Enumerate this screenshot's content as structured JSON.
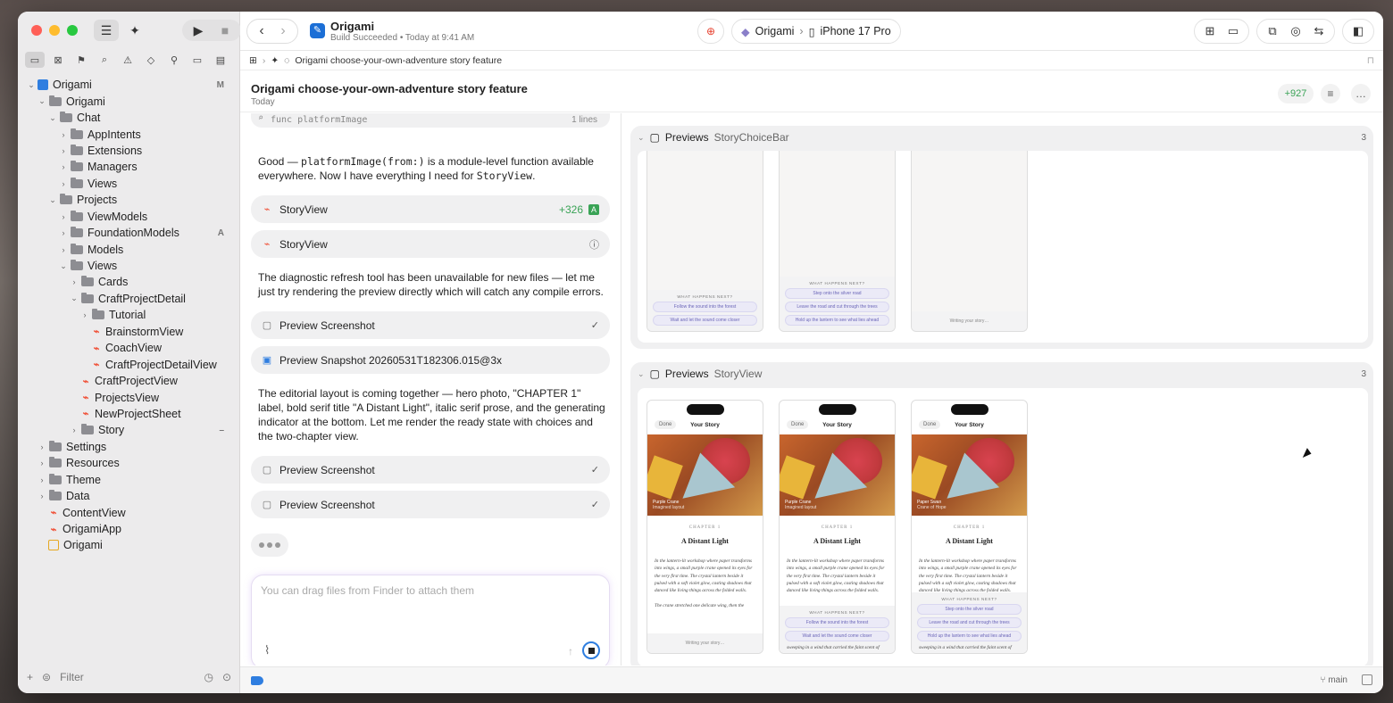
{
  "colors": {
    "accent": "#2f7ee0",
    "added": "#3aa356",
    "swift": "#f05138",
    "close": "#ff5f57",
    "minimize": "#febc2e",
    "zoom": "#28c840"
  },
  "toolbar": {
    "app_title": "Origami",
    "status": "Build Succeeded • Today at 9:41 AM",
    "scheme_app": "Origami",
    "scheme_device": "iPhone 17 Pro"
  },
  "jumpbar": {
    "path": "Origami choose-your-own-adventure story feature"
  },
  "header": {
    "title": "Origami choose-your-own-adventure story feature",
    "date": "Today",
    "diff": "+927"
  },
  "sidebar": {
    "filter_placeholder": "Filter",
    "items": [
      {
        "label": "Origami",
        "type": "project",
        "depth": 0,
        "open": true,
        "badge": "M"
      },
      {
        "label": "Origami",
        "type": "folder",
        "depth": 1,
        "open": true
      },
      {
        "label": "Chat",
        "type": "folder",
        "depth": 2,
        "open": true
      },
      {
        "label": "AppIntents",
        "type": "folder",
        "depth": 3,
        "open": false
      },
      {
        "label": "Extensions",
        "type": "folder",
        "depth": 3,
        "open": false
      },
      {
        "label": "Managers",
        "type": "folder",
        "depth": 3,
        "open": false
      },
      {
        "label": "Views",
        "type": "folder",
        "depth": 3,
        "open": false
      },
      {
        "label": "Projects",
        "type": "folder",
        "depth": 2,
        "open": true
      },
      {
        "label": "ViewModels",
        "type": "folder",
        "depth": 3,
        "open": false
      },
      {
        "label": "FoundationModels",
        "type": "folder",
        "depth": 3,
        "open": false,
        "badge": "A"
      },
      {
        "label": "Models",
        "type": "folder",
        "depth": 3,
        "open": false
      },
      {
        "label": "Views",
        "type": "folder",
        "depth": 3,
        "open": true
      },
      {
        "label": "Cards",
        "type": "folder",
        "depth": 4,
        "open": false
      },
      {
        "label": "CraftProjectDetail",
        "type": "folder",
        "depth": 4,
        "open": true
      },
      {
        "label": "Tutorial",
        "type": "folder",
        "depth": 5,
        "open": false
      },
      {
        "label": "BrainstormView",
        "type": "swift",
        "depth": 5
      },
      {
        "label": "CoachView",
        "type": "swift",
        "depth": 5
      },
      {
        "label": "CraftProjectDetailView",
        "type": "swift",
        "depth": 5
      },
      {
        "label": "CraftProjectView",
        "type": "swift",
        "depth": 4
      },
      {
        "label": "ProjectsView",
        "type": "swift",
        "depth": 4
      },
      {
        "label": "NewProjectSheet",
        "type": "swift",
        "depth": 4
      },
      {
        "label": "Story",
        "type": "folder",
        "depth": 4,
        "open": false,
        "badge": "–"
      },
      {
        "label": "Settings",
        "type": "folder",
        "depth": 1,
        "open": false
      },
      {
        "label": "Resources",
        "type": "folder",
        "depth": 1,
        "open": false
      },
      {
        "label": "Theme",
        "type": "folder",
        "depth": 1,
        "open": false
      },
      {
        "label": "Data",
        "type": "folder",
        "depth": 1,
        "open": false
      },
      {
        "label": "ContentView",
        "type": "swift",
        "depth": 1
      },
      {
        "label": "OrigamiApp",
        "type": "swift",
        "depth": 1
      },
      {
        "label": "Origami",
        "type": "asset",
        "depth": 1
      }
    ]
  },
  "chat": {
    "search_chip": {
      "query": "func platformImage",
      "count": "1 lines"
    },
    "msg1_pre": "Good — ",
    "msg1_code": "platformImage(from:)",
    "msg1_mid": " is a module-level function available everywhere. Now I have everything I need for ",
    "msg1_code2": "StoryView",
    "msg1_post": ".",
    "card1": {
      "label": "StoryView",
      "diff": "+326",
      "tag": "A"
    },
    "card2": {
      "label": "StoryView"
    },
    "msg2": "The diagnostic refresh tool has been unavailable for new files — let me just try rendering the preview directly which will catch any compile errors.",
    "card3": {
      "label": "Preview Screenshot"
    },
    "card4": {
      "label": "Preview Snapshot 20260531T182306.015@3x"
    },
    "msg3": "The editorial layout is coming together — hero photo, \"CHAPTER 1\" label, bold serif title \"A Distant Light\", italic serif prose, and the generating indicator at the bottom. Let me render the ready state with choices and the two-chapter view.",
    "card5": {
      "label": "Preview Screenshot"
    },
    "card6": {
      "label": "Preview Screenshot"
    },
    "composer_placeholder": "You can drag files from Finder to attach them"
  },
  "previews": {
    "group1": {
      "title": "Previews",
      "name": "StoryChoiceBar",
      "count": "3"
    },
    "group2": {
      "title": "Previews",
      "name": "StoryView",
      "count": "3"
    },
    "what_happens": "WHAT HAPPENS NEXT?",
    "choices": [
      "Follow the sound into the forest",
      "Wait and let the sound come closer"
    ],
    "choices_b": [
      "Step onto the silver road",
      "Leave the road and cut through the trees",
      "Hold up the lantern to see what lies ahead"
    ],
    "writing": "Writing your story…",
    "done": "Done",
    "story_title": "Your Story",
    "caption1": "Purple Crane",
    "caption1_sub": "Imagined layout",
    "caption3": "Paper Swan",
    "caption3_sub": "Crane of Hope",
    "chapter": "CHAPTER 1",
    "heading": "A Distant Light",
    "prose": "In the lantern-lit workshop where paper transforms into wings, a small purple crane opened its eyes for the very first time. The crystal lantern beside it pulsed with a soft violet glow, casting shadows that danced like living things across the folded walls.",
    "prose2": "The crane stretched one delicate wing, then the",
    "prose3": "sweeping in a wind that carried the faint scent of"
  },
  "bottombar": {
    "branch": "main"
  }
}
